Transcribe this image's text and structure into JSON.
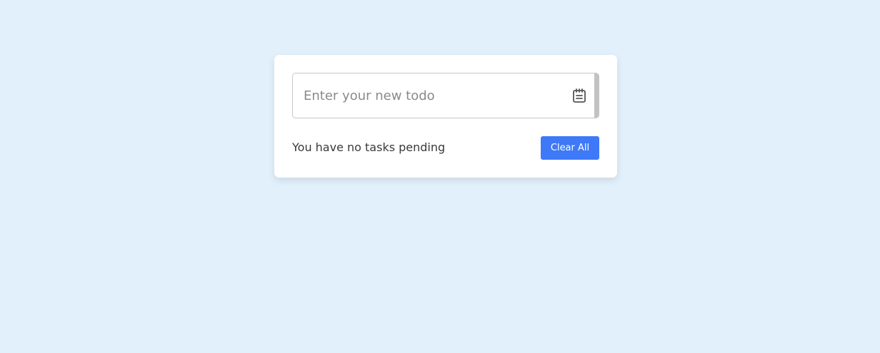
{
  "todo_input": {
    "value": "",
    "placeholder": "Enter your new todo",
    "icon": "notepad-icon"
  },
  "footer": {
    "status_text": "You have no tasks pending",
    "clear_label": "Clear All"
  },
  "colors": {
    "page_background": "#e2f0fc",
    "card_background": "#ffffff",
    "accent": "#3e79f7",
    "input_border": "#c6c6c6",
    "scroll_strip": "#c2c2c2",
    "text": "#3a3a3a",
    "placeholder": "#8a8a8a"
  }
}
